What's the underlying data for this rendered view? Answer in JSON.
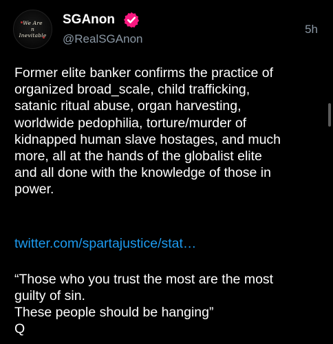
{
  "post": {
    "avatar": {
      "line1": "We Are",
      "line2": "n",
      "line3": "Inevitable"
    },
    "author": {
      "display_name": "SGAnon",
      "handle": "@RealSGAnon",
      "verified_icon": "verified-badge-icon",
      "verified_color": "#f91880"
    },
    "timestamp": "5h",
    "body_lines": [
      "Former elite banker confirms the practice of",
      "organized broad_scale, child trafficking,",
      "satanic ritual abuse, organ harvesting,",
      "worldwide pedophilia, torture/murder of",
      "kidnapped human slave hostages, and much",
      "more, all at the hands of the globalist elite",
      "and all done with the knowledge of those in",
      "power."
    ],
    "link": {
      "text": "twitter.com/spartajustice/stat…",
      "color": "#1d9bf0"
    },
    "quote_lines": [
      "“Those who you trust the most are the most",
      "guilty of sin.",
      "These people should be hanging”",
      "Q"
    ]
  },
  "colors": {
    "background": "#000000",
    "text": "#ffffff",
    "secondary_text": "#8b98a5"
  }
}
